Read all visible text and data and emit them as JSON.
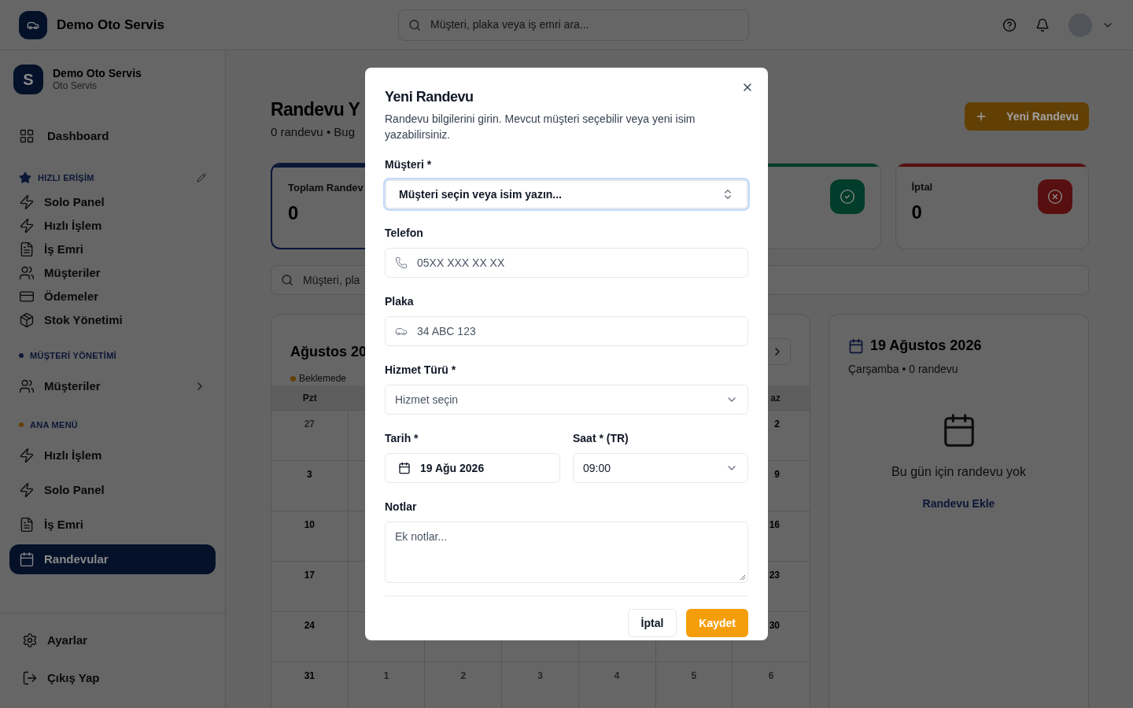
{
  "topbar": {
    "brand": "Demo Oto Servis",
    "search_placeholder": "Müşteri, plaka veya iş emri ara..."
  },
  "sidebar": {
    "org": {
      "initial": "S",
      "name": "Demo Oto Servis",
      "subtitle": "Oto Servis"
    },
    "top_item": {
      "label": "Dashboard",
      "selected": false
    },
    "sections": [
      {
        "kind": "favorites",
        "title": "HIZLI ERİŞİM",
        "items": [
          {
            "label": "Solo Panel",
            "selected": false
          },
          {
            "label": "Hızlı İşlem",
            "selected": false
          },
          {
            "label": "İş Emri",
            "selected": false
          },
          {
            "label": "Müşteriler",
            "selected": false
          },
          {
            "label": "Ödemeler",
            "selected": false
          },
          {
            "label": "Stok Yönetimi",
            "selected": false
          }
        ]
      },
      {
        "kind": "group",
        "title": "MÜŞTERİ YÖNETİMİ",
        "color": "#0c1737",
        "items": [
          {
            "label": "Müşteriler",
            "selected": false,
            "expanded": false
          }
        ]
      },
      {
        "kind": "group",
        "title": "ANA MENÜ",
        "color": "#623f04",
        "items": [
          {
            "label": "Hızlı İşlem",
            "selected": false
          },
          {
            "label": "Solo Panel",
            "selected": false
          },
          {
            "label": "İş Emri",
            "selected": false
          },
          {
            "label": "Randevular",
            "selected": true
          }
        ]
      }
    ],
    "footer": [
      {
        "kind": "settings",
        "label": "Ayarlar"
      },
      {
        "kind": "logout",
        "label": "Çıkış Yap"
      }
    ]
  },
  "page": {
    "title": "Randevu Y",
    "subtitle": "0 randevu • Bug",
    "new_button": "Yeni Randevu"
  },
  "stats": [
    {
      "kind": "total",
      "label": "Toplam Randev",
      "value": "0",
      "color": "#0c1737",
      "selected": true
    },
    {
      "kind": "completed",
      "color": "#023c2a",
      "selected": false
    },
    {
      "kind": "cancelled",
      "label": "İptal",
      "value": "0",
      "color": "#580f0f",
      "selected": false
    }
  ],
  "search": {
    "placeholder": "Müşteri, pla"
  },
  "calendar": {
    "title": "Ağustos 20",
    "legend": [
      {
        "label": "Beklemede",
        "color": "#623f04"
      }
    ],
    "header": {
      "monday": "Pzt",
      "sunday": "az"
    },
    "weeks": [
      {
        "monday": {
          "text": "27",
          "muted": true
        },
        "sunday": {
          "text": "2",
          "muted": false
        }
      },
      {
        "monday": {
          "text": "3",
          "muted": false
        },
        "sunday": {
          "text": "9",
          "muted": false
        }
      },
      {
        "monday": {
          "text": "10",
          "muted": false
        },
        "sunday": {
          "text": "16",
          "muted": false
        }
      },
      {
        "monday": {
          "text": "17",
          "muted": false
        },
        "sunday": {
          "text": "23",
          "muted": false
        }
      },
      {
        "monday": {
          "text": "24",
          "muted": false
        },
        "sunday": {
          "text": "30",
          "muted": false
        }
      }
    ],
    "last_week": [
      {
        "text": "31",
        "muted": false
      },
      {
        "text": "1",
        "muted": true
      },
      {
        "text": "2",
        "muted": true
      },
      {
        "text": "3",
        "muted": true
      },
      {
        "text": "4",
        "muted": true
      },
      {
        "text": "5",
        "muted": true
      },
      {
        "text": "6",
        "muted": true
      }
    ]
  },
  "day_panel": {
    "title": "19 Ağustos 2026",
    "subtitle": "Çarşamba • 0 randevu",
    "empty_text": "Bu gün için randevu yok",
    "link": "Randevu Ekle"
  },
  "modal": {
    "title": "Yeni Randevu",
    "description": "Randevu bilgilerini girin. Mevcut müşteri seçebilir veya yeni isim yazabilirsiniz.",
    "fields": [
      {
        "kind": "combobox",
        "label": "Müşteri *",
        "placeholder": "Müşteri seçin veya isim yazın...",
        "focused": true
      },
      {
        "kind": "phone",
        "label": "Telefon",
        "placeholder": "05XX XXX XX XX"
      },
      {
        "kind": "plate",
        "label": "Plaka",
        "placeholder": "34 ABC 123"
      },
      {
        "kind": "select",
        "label": "Hizmet Türü *",
        "placeholder": "Hizmet seçin"
      },
      {
        "kind": "row",
        "children": [
          {
            "kind": "date",
            "label": "Tarih *",
            "value": "19 Ağu 2026"
          },
          {
            "kind": "select",
            "label": "Saat * (TR)",
            "value": "09:00"
          }
        ]
      },
      {
        "kind": "textarea",
        "label": "Notlar",
        "placeholder": "Ek notlar..."
      }
    ],
    "buttons": [
      {
        "kind": "secondary",
        "label": "İptal"
      },
      {
        "kind": "primary",
        "label": "Kaydet"
      }
    ]
  }
}
